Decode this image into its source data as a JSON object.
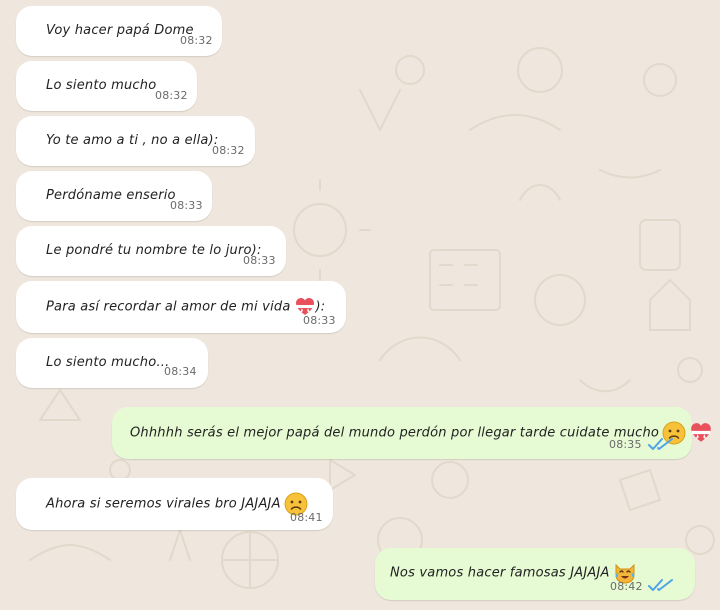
{
  "messages": [
    {
      "text": "Voy hacer papá Dome",
      "time": "08:32",
      "direction": "in"
    },
    {
      "text": "Lo siento mucho",
      "time": "08:32",
      "direction": "in"
    },
    {
      "text": "Yo te amo a ti , no a ella):",
      "time": "08:32",
      "direction": "in"
    },
    {
      "text": "Perdóname enserio",
      "time": "08:33",
      "direction": "in"
    },
    {
      "text": "Le pondré tu nombre te lo juro):",
      "time": "08:33",
      "direction": "in"
    },
    {
      "text": "Para así recordar al amor de mi vida",
      "text_after": "):",
      "time": "08:33",
      "direction": "in",
      "emoji": "heart-with-ribbon-icon"
    },
    {
      "text": "Lo siento mucho…",
      "time": "08:34",
      "direction": "in"
    },
    {
      "text": "Ohhhhh serás el mejor papá del mundo perdón por llegar tarde cuidate mucho",
      "time": "08:35",
      "direction": "out",
      "emoji": [
        "sad-face-icon",
        "heart-with-ribbon-icon"
      ],
      "status": "read"
    },
    {
      "text": "Ahora si seremos virales bro JAJAJA",
      "time": "08:41",
      "direction": "in",
      "emoji": "sad-face-icon"
    },
    {
      "text": "Nos vamos hacer famosas JAJAJA",
      "time": "08:42",
      "direction": "out",
      "emoji": "cat-tears-of-joy-icon",
      "status": "read"
    }
  ],
  "colors": {
    "background": "#efe7dd",
    "incoming_bubble": "#ffffff",
    "outgoing_bubble": "#e6fbd3",
    "read_ticks": "#4fa3e8"
  }
}
